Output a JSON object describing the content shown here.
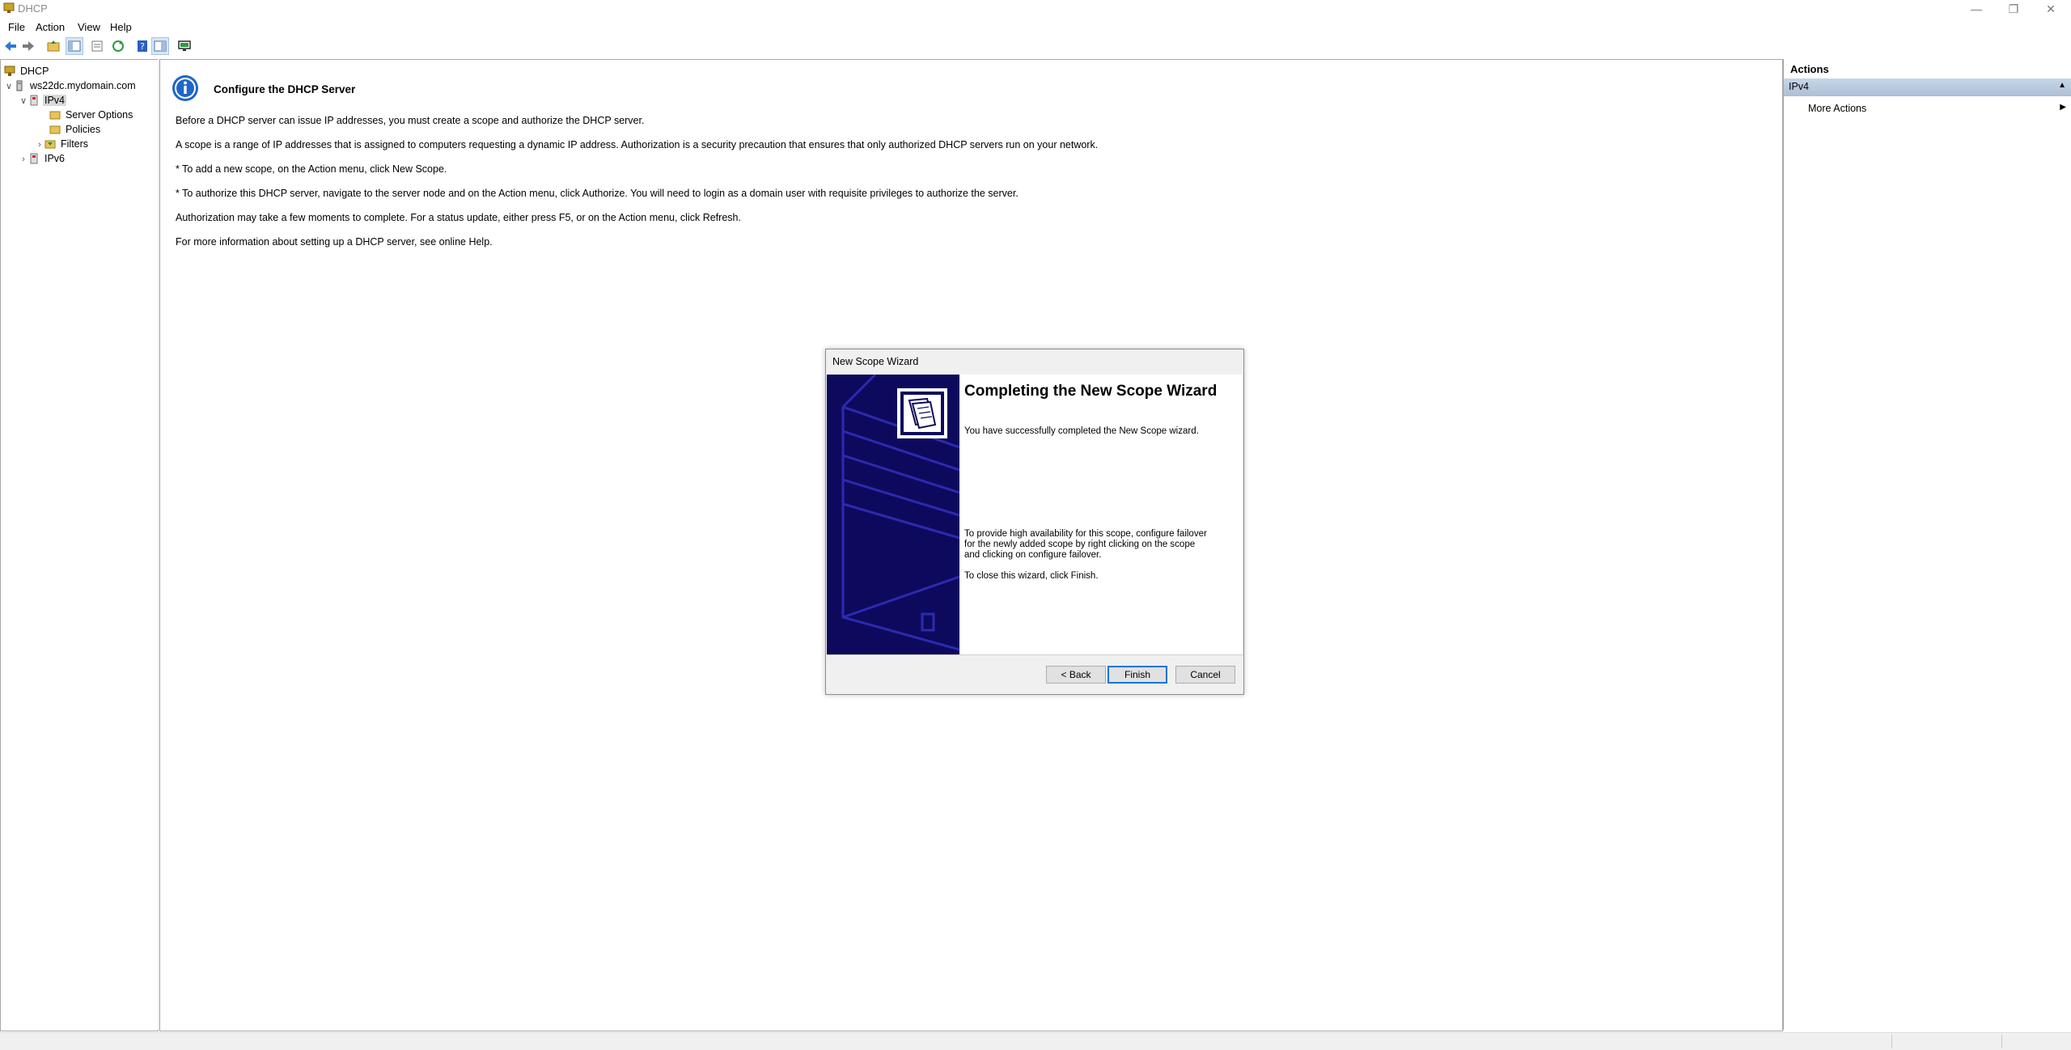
{
  "window": {
    "title": "DHCP",
    "minimize": "—",
    "restore": "❐",
    "close": "✕"
  },
  "menu": [
    "File",
    "Action",
    "View",
    "Help"
  ],
  "toolbar": [
    "back-arrow-icon",
    "forward-arrow-icon",
    "up-folder-icon",
    "show-hide-tree-icon",
    "export-list-icon",
    "refresh-icon",
    "help-icon",
    "properties-icon",
    "monitor-icon"
  ],
  "tree": {
    "root": "DHCP",
    "server": "ws22dc.mydomain.com",
    "ipv4": "IPv4",
    "server_options": "Server Options",
    "policies": "Policies",
    "filters": "Filters",
    "ipv6": "IPv6"
  },
  "content": {
    "heading": "Configure the DHCP Server",
    "p1": "Before a DHCP server can issue IP addresses, you must create a scope and authorize the DHCP server.",
    "p2": "A scope is a range of IP addresses that is assigned to computers requesting a dynamic IP address. Authorization is a security precaution that ensures that only authorized DHCP servers run on your network.",
    "p3": "* To add a new scope, on the Action menu, click New Scope.",
    "p4": "* To authorize this DHCP server, navigate to the server node and on the Action menu, click Authorize. You will need to login as a domain user with requisite privileges to authorize the server.",
    "p5": "Authorization may take a few moments to complete. For a status update, either press F5, or on the Action menu, click Refresh.",
    "p6": "For more information about setting up a DHCP server, see online Help."
  },
  "actions": {
    "title": "Actions",
    "section": "IPv4",
    "more": "More Actions"
  },
  "wizard": {
    "title": "New Scope Wizard",
    "heading": "Completing the New Scope Wizard",
    "success": "You have successfully completed the New Scope wizard.",
    "failover": "To provide high availability for this scope, configure failover for the newly added scope by right clicking on the scope and clicking on configure failover.",
    "close_hint": "To close this wizard, click Finish.",
    "back": "< Back",
    "finish": "Finish",
    "cancel": "Cancel"
  },
  "colors": {
    "banner": "#0d0a5e",
    "banner_lines": "#2c2ab0",
    "accent": "#0078d7",
    "info_blue": "#1e66c8"
  }
}
